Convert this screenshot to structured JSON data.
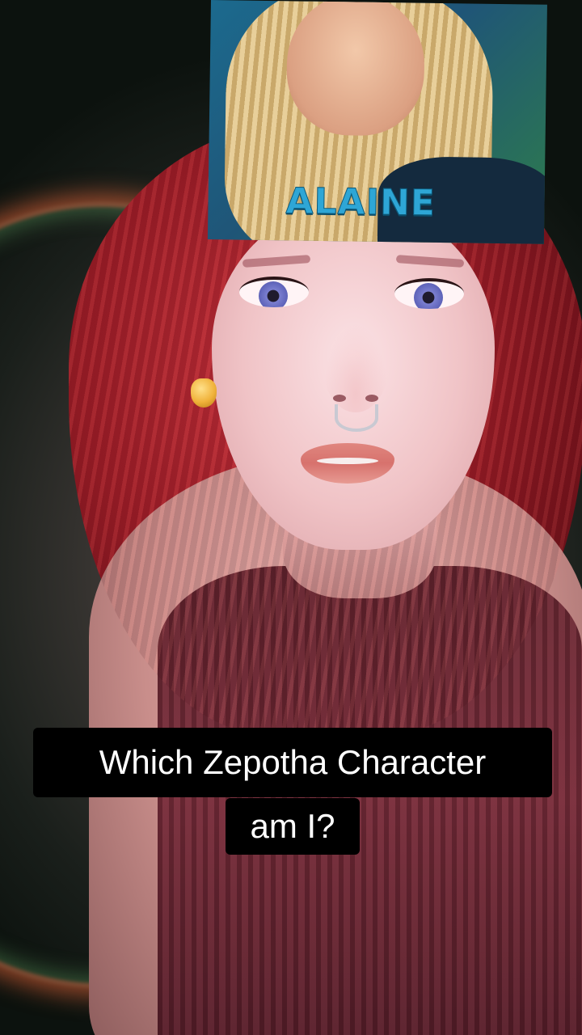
{
  "inset": {
    "name_caption": "ALAINE"
  },
  "caption": {
    "line1": "Which Zepotha Character",
    "line2": "am I?"
  },
  "colors": {
    "caption_bg": "#000000",
    "caption_text": "#ffffff",
    "inset_caption": "#2ea6d6",
    "hair": "#9a1d27"
  }
}
